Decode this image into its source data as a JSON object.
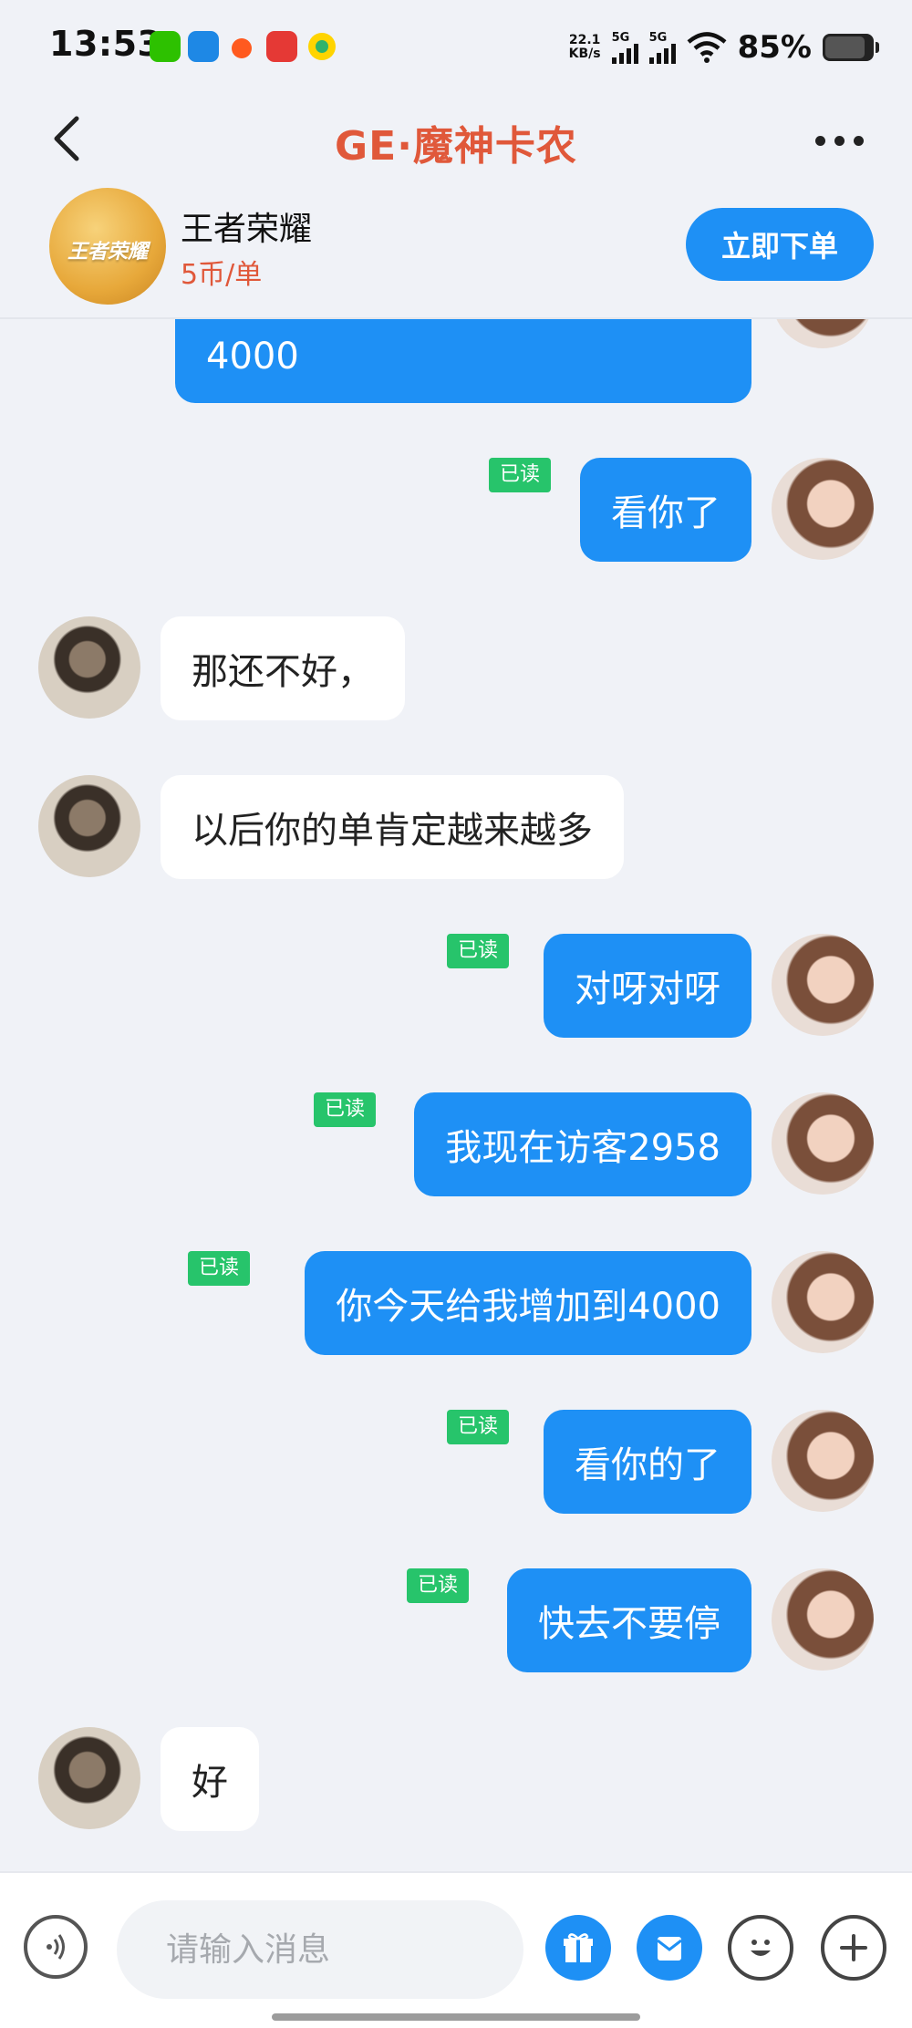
{
  "status_bar": {
    "time": "13:53",
    "net_speed_value": "22.1",
    "net_speed_unit": "KB/s",
    "sim1": "5G",
    "sim2": "5G",
    "battery_percent": "85%",
    "battery_level": 0.85
  },
  "header": {
    "title": "GE·魔神卡农"
  },
  "product": {
    "game_name": "王者荣耀",
    "logo_text": "王者荣耀",
    "price": "5币/单",
    "order_button": "立即下单"
  },
  "messages": [
    {
      "sender": "me",
      "text": "4000",
      "partial": true
    },
    {
      "sender": "me",
      "text": "看你了",
      "read_label": "已读"
    },
    {
      "sender": "other",
      "text": "那还不好，"
    },
    {
      "sender": "other",
      "text": "以后你的单肯定越来越多"
    },
    {
      "sender": "me",
      "text": "对呀对呀",
      "read_label": "已读"
    },
    {
      "sender": "me",
      "text": "我现在访客2958",
      "read_label": "已读"
    },
    {
      "sender": "me",
      "text": "你今天给我增加到4000",
      "read_label": "已读"
    },
    {
      "sender": "me",
      "text": "看你的了",
      "read_label": "已读"
    },
    {
      "sender": "me",
      "text": "快去不要停",
      "read_label": "已读"
    },
    {
      "sender": "other",
      "text": "好"
    }
  ],
  "input_bar": {
    "placeholder": "请输入消息"
  },
  "colors": {
    "accent": "#1e90f5",
    "title": "#e0583a",
    "read_badge": "#27c46b"
  }
}
